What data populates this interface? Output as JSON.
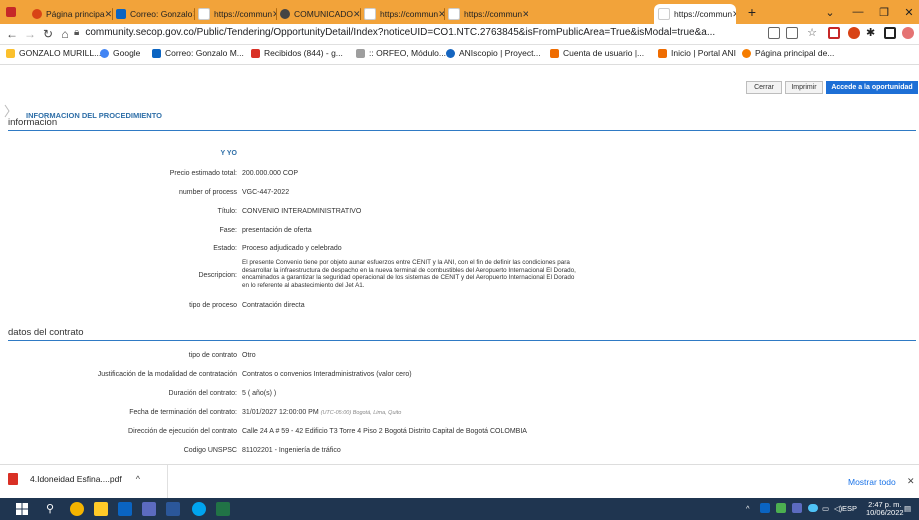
{
  "browser": {
    "tabs": [
      {
        "label": "Página principa"
      },
      {
        "label": "Correo: Gonzalo"
      },
      {
        "label": "https://commun"
      },
      {
        "label": "COMUNICADO"
      },
      {
        "label": "https://commun"
      },
      {
        "label": "https://commun"
      },
      {
        "label": "https://commun"
      }
    ],
    "new_tab": "+",
    "url": "community.secop.gov.co/Public/Tendering/OpportunityDetail/Index?noticeUID=CO1.NTC.2763845&isFromPublicArea=True&isModal=true&a...",
    "bookmarks": [
      {
        "label": "GONZALO MURILL..."
      },
      {
        "label": "Google"
      },
      {
        "label": "Correo: Gonzalo M..."
      },
      {
        "label": "Recibidos (844) - g..."
      },
      {
        "label": ":: ORFEO, Módulo..."
      },
      {
        "label": "ANIscopio | Proyect..."
      },
      {
        "label": "Cuenta de usuario |..."
      },
      {
        "label": "Inicio | Portal ANI"
      },
      {
        "label": "Página principal de..."
      }
    ]
  },
  "actions": {
    "close": "Cerrar",
    "print": "Imprimir",
    "access": "Accede a la oportunidad"
  },
  "procedure": {
    "heading": "INFORMACION DEL PROCEDIMIENTO",
    "section": "informacion",
    "entity": "Y YO",
    "rows": [
      {
        "label": "Precio estimado total:",
        "value": "200.000.000 COP"
      },
      {
        "label": "number of process",
        "value": "VGC-447-2022"
      },
      {
        "label": "Título:",
        "value": "CONVENIO INTERADMINISTRATIVO"
      },
      {
        "label": "Fase:",
        "value": "presentación de oferta"
      },
      {
        "label": "Estado:",
        "value": "Proceso adjudicado y celebrado"
      }
    ],
    "description_label": "Descripcion:",
    "description_lines": [
      "El presente Convenio tiene por objeto aunar esfuerzos entre CENIT y la ANI, con el fin de definir las condiciones para",
      "desarrollar la infraestructura de despacho en la nueva terminal de combustibles del Aeropuerto Internacional El Dorado,",
      "encaminados a garantizar la seguridad operacional de los sistemas de CENIT y del Aeropuerto Internacional El Dorado",
      "en lo referente al abastecimiento del Jet A1."
    ],
    "process_type_label": "tipo de proceso",
    "process_type_value": "Contratación directa"
  },
  "contract": {
    "section": "datos del contrato",
    "rows": [
      {
        "label": "tipo de contrato",
        "value": "Otro"
      },
      {
        "label": "Justificación de la modalidad de contratación",
        "value": "Contratos o convenios Interadministrativos (valor cero)"
      },
      {
        "label": "Duración del contrato:",
        "value": "5 ( año(s) )"
      },
      {
        "label": "Fecha de terminación del contrato:",
        "value": "31/01/2027 12:00:00 PM",
        "note": "(UTC-05:00) Bogotá, Lima, Quito"
      },
      {
        "label": "Dirección de ejecución del contrato",
        "value": "Calle 24 A # 59 - 42 Edificio T3 Torre 4 Piso 2 Bogotá Distrito Capital de Bogotá COLOMBIA"
      },
      {
        "label": "Codigo UNSPSC",
        "value": "81102201 - Ingeniería de tráfico"
      }
    ]
  },
  "downloads": {
    "file": "4.Idoneidad Esfina....pdf",
    "show_all": "Mostrar todo"
  },
  "taskbar": {
    "lang": "ESP",
    "time": "2:47 p. m.",
    "date": "10/06/2022"
  },
  "colors": {
    "tabstrip": "#f2a33a",
    "accent": "#1d6fd6",
    "link": "#2f6fa8",
    "taskbar": "#1f3550"
  }
}
